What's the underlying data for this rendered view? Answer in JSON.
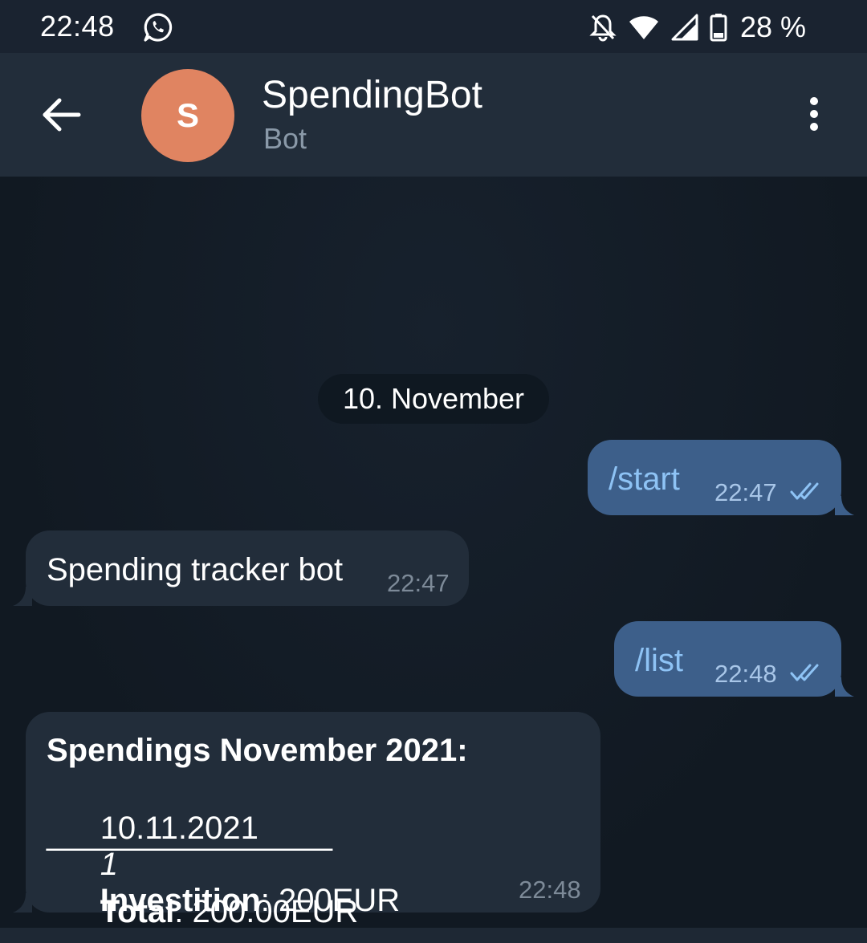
{
  "status_bar": {
    "time": "22:48",
    "battery": "28 %",
    "icons": [
      "whatsapp-icon",
      "bell-off-icon",
      "wifi-icon",
      "signal-icon",
      "battery-icon"
    ]
  },
  "header": {
    "back_icon": "arrow-back-icon",
    "avatar_letter": "S",
    "avatar_color": "#e08461",
    "title": "SpendingBot",
    "subtitle": "Bot",
    "menu_icon": "more-vert-icon"
  },
  "chat": {
    "date_chip": "10. November",
    "messages": [
      {
        "direction": "out",
        "text": "/start",
        "time": "22:47",
        "status": "read"
      },
      {
        "direction": "in",
        "text": "Spending tracker bot",
        "time": "22:47"
      },
      {
        "direction": "out",
        "text": "/list",
        "time": "22:48",
        "status": "read"
      },
      {
        "direction": "in",
        "time": "22:48",
        "report": {
          "heading": "Spendings November 2021:",
          "entry_date": "10.11.2021",
          "entry_count": "1",
          "entry_label": "Investition",
          "entry_amount": ": 200EUR",
          "separator": "________________",
          "total_label": "Total",
          "total_amount": ": 200.00EUR"
        }
      }
    ]
  },
  "colors": {
    "background": "#131c27",
    "header": "#222d3a",
    "outgoing_bubble": "#3d5f8a",
    "incoming_bubble": "#222d3a",
    "outgoing_text": "#8ec3f5"
  }
}
